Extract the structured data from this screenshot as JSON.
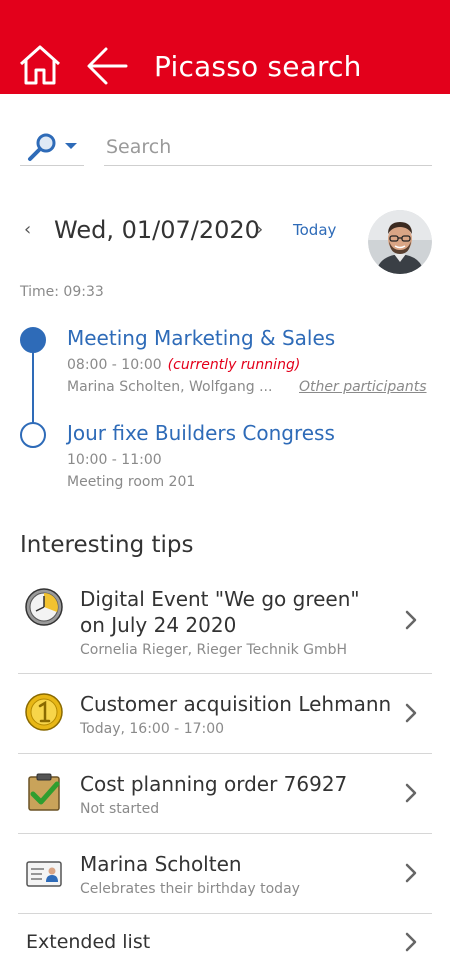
{
  "header": {
    "title": "Picasso search",
    "background": "#e3001b"
  },
  "search": {
    "placeholder": "Search",
    "value": ""
  },
  "date_nav": {
    "date": "Wed, 01/07/2020",
    "prev_icon": "chevron-left-icon",
    "next_icon": "chevron-right-icon",
    "today_label": "Today"
  },
  "time": {
    "label": "Time: 09:33"
  },
  "events": [
    {
      "title": "Meeting Marketing & Sales",
      "time": "08:00 - 10:00",
      "status": "(currently running)",
      "participants": "Marina Scholten, Wolfgang ...",
      "other_participants": "Other participants"
    },
    {
      "title": "Jour fixe Builders Congress",
      "time": "10:00 - 11:00",
      "location": "Meeting room 201"
    }
  ],
  "tips": {
    "heading": "Interesting tips",
    "items": [
      {
        "icon": "event-clock-icon",
        "title_line1": "Digital Event \"We go green\"",
        "title_line2": "on July 24 2020",
        "subtitle": "Cornelia Rieger, Rieger Technik GmbH"
      },
      {
        "icon": "gold-coin-icon",
        "title": "Customer acquisition Lehmann",
        "subtitle": "Today, 16:00 - 17:00"
      },
      {
        "icon": "clipboard-check-icon",
        "title": "Cost planning order 76927",
        "subtitle": "Not started"
      },
      {
        "icon": "contact-card-icon",
        "title": "Marina Scholten",
        "subtitle": "Celebrates their birthday today"
      }
    ]
  },
  "extended": {
    "label": "Extended list"
  },
  "colors": {
    "accent_blue": "#2e6bb8",
    "running_red": "#e3001b"
  }
}
